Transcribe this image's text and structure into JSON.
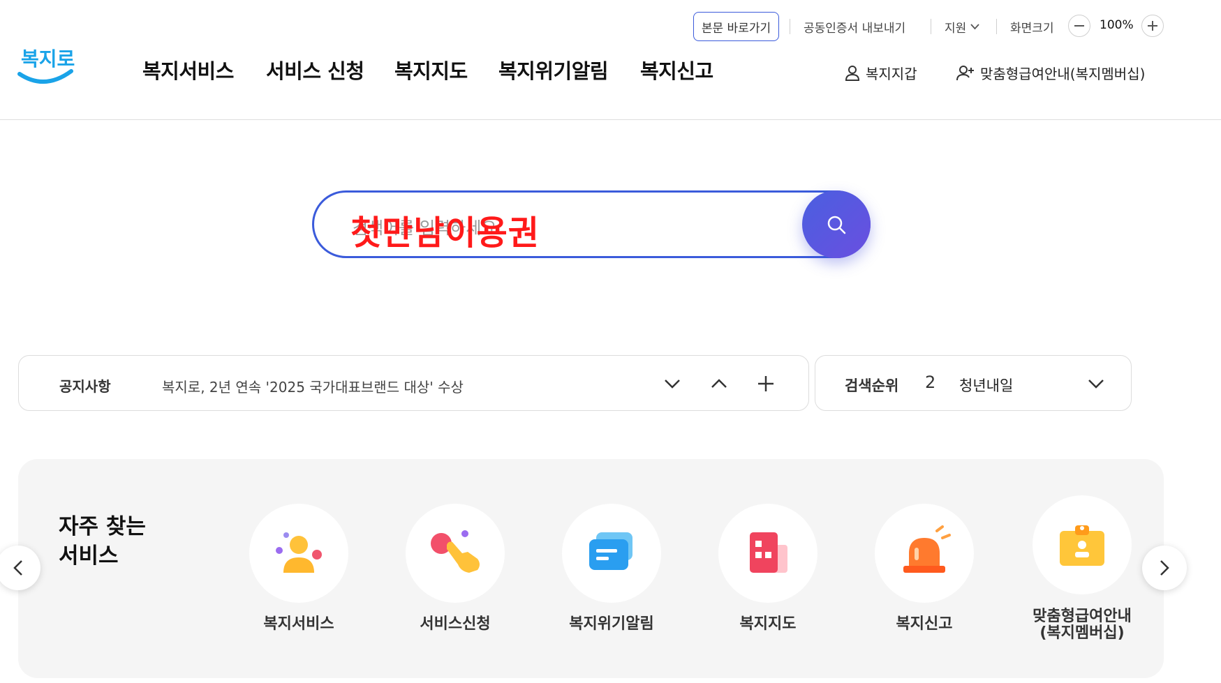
{
  "utility_bar": {
    "skip_to_content": "본문 바로가기",
    "cert_export": "공동인증서 내보내기",
    "support": "지원",
    "screen_size_label": "화면크기",
    "zoom_level": "100%"
  },
  "logo": {
    "text": "복지로"
  },
  "nav": {
    "items": [
      "복지서비스",
      "서비스 신청",
      "복지지도",
      "복지위기알림",
      "복지신고"
    ]
  },
  "header_links": {
    "wallet": "복지지갑",
    "membership": "맞춤형급여안내(복지멤버십)"
  },
  "search": {
    "placeholder": "검색어를 입력하세요",
    "typed_value": "첫만남이용권"
  },
  "notice": {
    "label": "공지사항",
    "text": "복지로, 2년 연속 '2025 국가대표브랜드 대상' 수상"
  },
  "ranking": {
    "label": "검색순위",
    "rank": "2",
    "keyword": "청년내일"
  },
  "frequent": {
    "title_line1": "자주 찾는",
    "title_line2": "서비스",
    "items": [
      {
        "label": "복지서비스",
        "icon": "person-icon"
      },
      {
        "label": "서비스신청",
        "icon": "tap-hand-icon"
      },
      {
        "label": "복지위기알림",
        "icon": "message-icon"
      },
      {
        "label": "복지지도",
        "icon": "map-building-icon"
      },
      {
        "label": "복지신고",
        "icon": "siren-icon"
      },
      {
        "label_line1": "맞춤형급여안내",
        "label_line2": "(복지멤버십)",
        "icon": "id-card-icon"
      }
    ]
  },
  "colors": {
    "accent": "#3b5bdb",
    "search_typed": "#ff1a1a",
    "logo_blue": "#1aa3e8"
  }
}
